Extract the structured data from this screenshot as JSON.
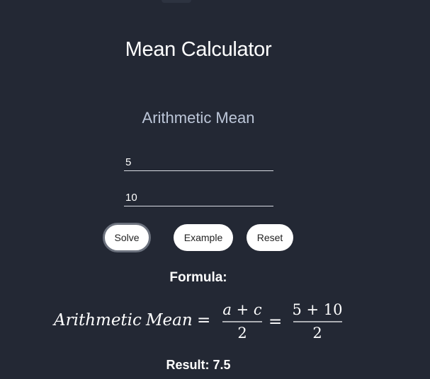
{
  "page": {
    "title": "Mean Calculator"
  },
  "calculator": {
    "section_title": "Arithmetic Mean",
    "inputs": {
      "a": {
        "value": "5"
      },
      "c": {
        "value": "10"
      }
    },
    "buttons": {
      "solve": "Solve",
      "example": "Example",
      "reset": "Reset"
    },
    "formula": {
      "label": "Formula:",
      "lhs_word1": "Arithmetic",
      "lhs_word2": "Mean",
      "equals": "=",
      "symbolic_numerator": "a + c",
      "symbolic_denominator": "2",
      "numeric_numerator": "5 + 10",
      "numeric_denominator": "2"
    },
    "result": "Result: 7.5"
  },
  "colors": {
    "background": "#232834",
    "subtitle": "#bcc6d8",
    "button_bg": "#ffffff",
    "solve_border": "#6c727e"
  }
}
